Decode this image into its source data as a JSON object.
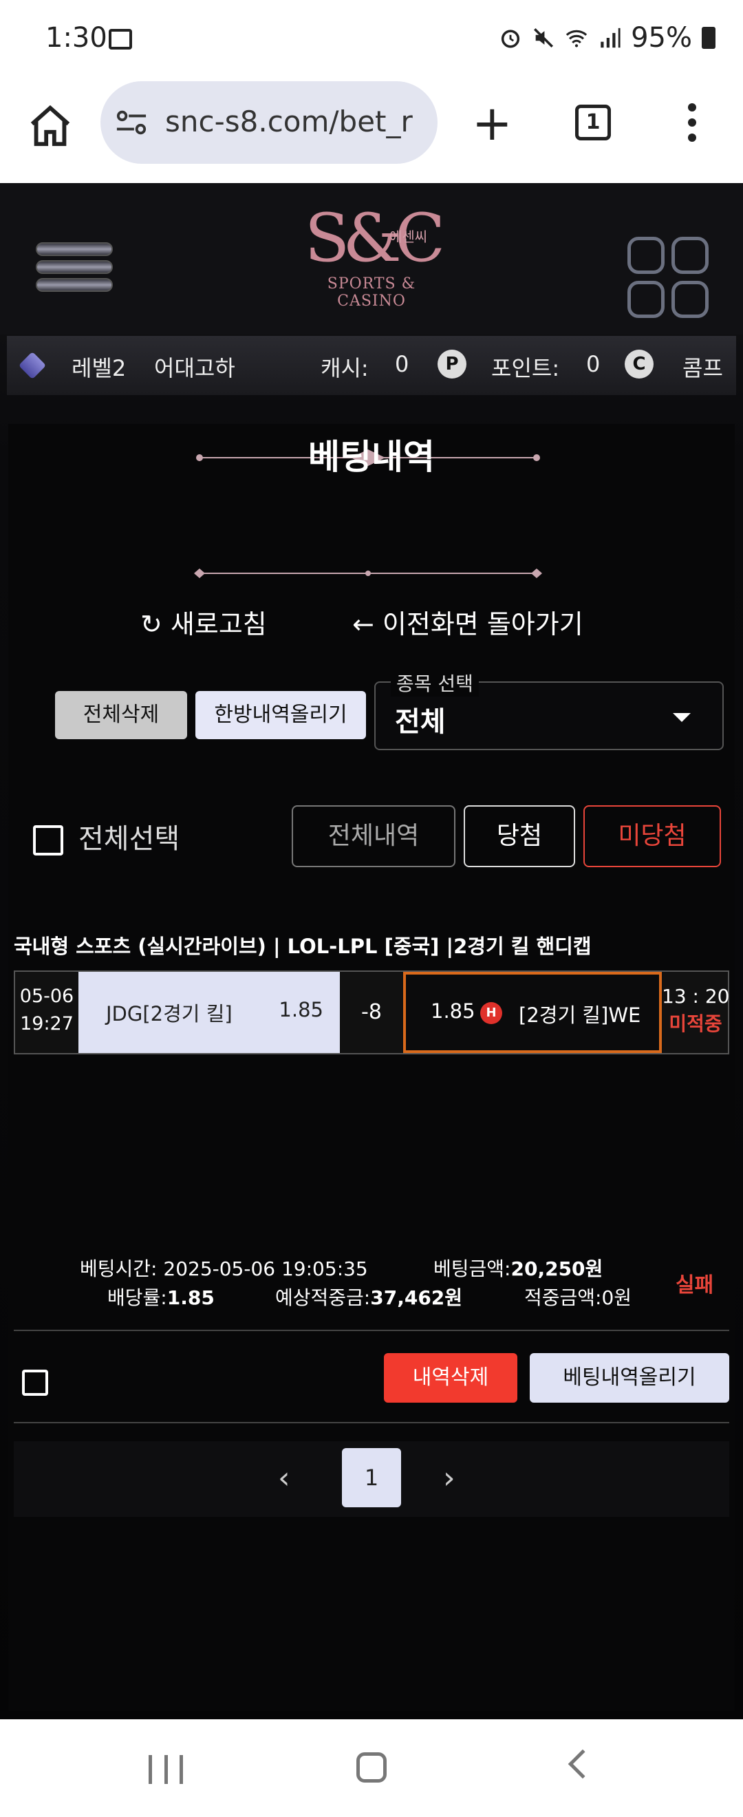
{
  "status": {
    "time": "1:30",
    "battery": "95%"
  },
  "browser": {
    "url": "snc-s8.com/bet_r",
    "tab_count": "1"
  },
  "site": {
    "logo_text": "S&C",
    "logo_korean": "에센씨",
    "logo_sub": "SPORTS & CASINO"
  },
  "user": {
    "level": "레벨2",
    "name": "어대고하",
    "cash_label": "캐시:",
    "cash_value": "0",
    "point_label": "포인트:",
    "point_value": "0",
    "comp_label": "콤프",
    "p_badge": "P",
    "c_badge": "C"
  },
  "page": {
    "title": "베팅내역",
    "refresh": "새로고침",
    "back": "이전화면 돌아가기",
    "delete_all": "전체삭제",
    "bulk_upload": "한방내역올리기",
    "select_legend": "종목 선택",
    "select_value": "전체",
    "select_all": "전체선택",
    "filter_all": "전체내역",
    "filter_win": "당첨",
    "filter_lose": "미당첨"
  },
  "bet": {
    "title": "국내형 스포츠 (실시간라이브) | LOL-LPL [중국]  |2경기 킬 핸디캡",
    "date": "05-06",
    "time": "19:27",
    "home_name": "JDG[2경기 킬]",
    "home_odds": "1.85",
    "handicap": "-8",
    "away_odds": "1.85",
    "away_badge": "H",
    "away_name": "[2경기 킬]WE",
    "score": "13 : 20",
    "match_status": "미적중",
    "bet_time": "베팅시간: 2025-05-06 19:05:35",
    "bet_amount_label": "베팅금액:",
    "bet_amount": "20,250원",
    "payout_label": "배당률:",
    "payout": "1.85",
    "expected_label": "예상적중금:",
    "expected": "37,462원",
    "win_amount": "적중금액:0원",
    "result": "실패",
    "row_delete": "내역삭제",
    "row_upload": "베팅내역올리기"
  },
  "pager": {
    "prev": "‹",
    "current": "1",
    "next": "›"
  }
}
